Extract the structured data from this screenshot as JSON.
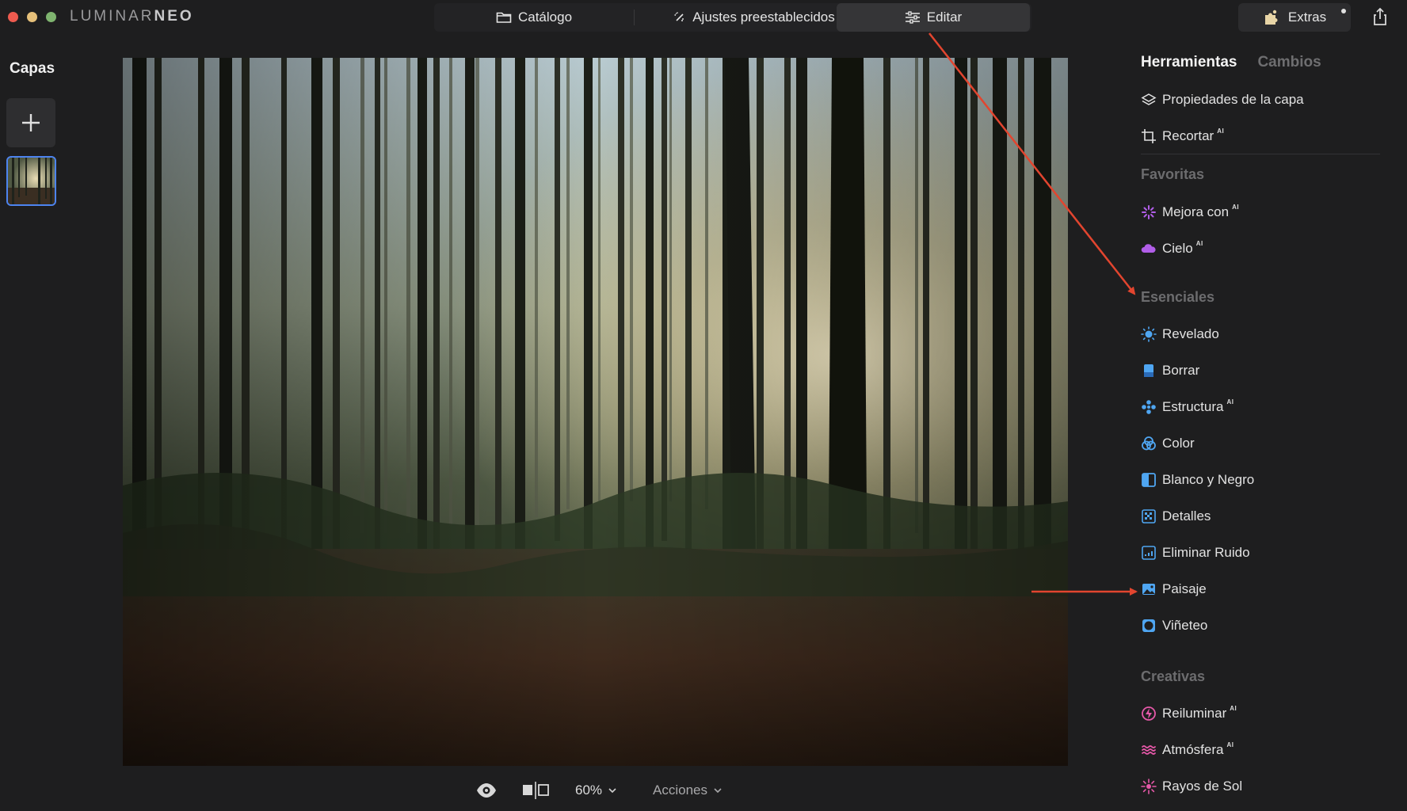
{
  "app": {
    "logo_light": "LUMINAR",
    "logo_bold": "NEO"
  },
  "modes": {
    "catalog": "Catálogo",
    "presets": "Ajustes preestablecidos",
    "edit": "Editar",
    "active": "edit"
  },
  "extras": {
    "label": "Extras"
  },
  "layers": {
    "title": "Capas"
  },
  "bottom": {
    "zoom": "60%",
    "actions": "Acciones"
  },
  "panel": {
    "tab_tools": "Herramientas",
    "tab_changes": "Cambios",
    "ai_badge": "AI",
    "top_tools": [
      {
        "label": "Propiedades de la capa",
        "icon": "layers-icon",
        "ai": false
      },
      {
        "label": "Recortar",
        "icon": "crop-icon",
        "ai": true
      }
    ],
    "sections": {
      "favorites": "Favoritas",
      "essentials": "Esenciales",
      "creative": "Creativas"
    },
    "favorites": [
      {
        "label": "Mejora con",
        "icon": "sparkle-icon",
        "ai": true
      },
      {
        "label": "Cielo",
        "icon": "cloud-icon",
        "ai": true
      }
    ],
    "essentials": [
      {
        "label": "Revelado",
        "icon": "sun-icon",
        "ai": false
      },
      {
        "label": "Borrar",
        "icon": "eraser-icon",
        "ai": false
      },
      {
        "label": "Estructura",
        "icon": "structure-icon",
        "ai": true
      },
      {
        "label": "Color",
        "icon": "color-circles-icon",
        "ai": false
      },
      {
        "label": "Blanco y Negro",
        "icon": "bw-icon",
        "ai": false
      },
      {
        "label": "Detalles",
        "icon": "details-grid-icon",
        "ai": false
      },
      {
        "label": "Eliminar Ruido",
        "icon": "noise-icon",
        "ai": false
      },
      {
        "label": "Paisaje",
        "icon": "landscape-icon",
        "ai": false
      },
      {
        "label": "Viñeteo",
        "icon": "vignette-icon",
        "ai": false
      }
    ],
    "creative": [
      {
        "label": "Reiluminar",
        "icon": "relight-icon",
        "ai": true
      },
      {
        "label": "Atmósfera",
        "icon": "atmosphere-icon",
        "ai": true
      },
      {
        "label": "Rayos de Sol",
        "icon": "sunrays-icon",
        "ai": false
      }
    ]
  },
  "colors": {
    "background": "#1e1e1f",
    "accent_blue": "#4d84f0",
    "annotation_arrow": "#e2452f",
    "section_text": "#6c6c6e"
  }
}
